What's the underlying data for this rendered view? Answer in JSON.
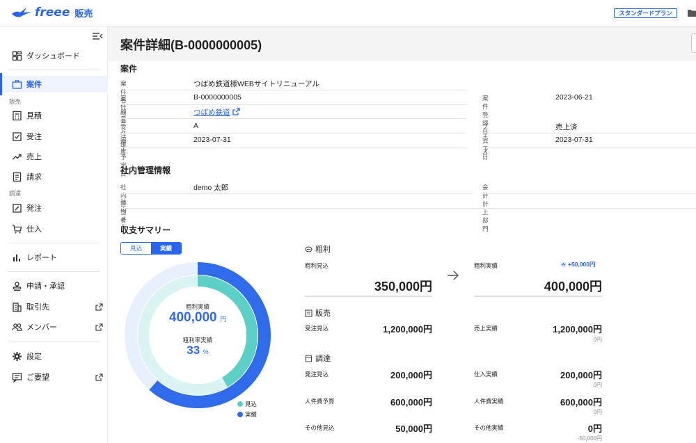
{
  "app": {
    "brand": "freee",
    "product": "販売",
    "plan_badge": "スタンダードプラン"
  },
  "sidebar": {
    "items": [
      {
        "id": "dashboard",
        "label": "ダッシュボード"
      },
      {
        "id": "deals",
        "label": "案件",
        "active": true
      },
      {
        "id": "estimate",
        "label": "見積"
      },
      {
        "id": "order",
        "label": "受注"
      },
      {
        "id": "sales",
        "label": "売上"
      },
      {
        "id": "billing",
        "label": "請求"
      },
      {
        "id": "purchase-order",
        "label": "発注"
      },
      {
        "id": "purchase",
        "label": "仕入"
      },
      {
        "id": "report",
        "label": "レポート"
      },
      {
        "id": "approval",
        "label": "申請・承認"
      },
      {
        "id": "partners",
        "label": "取引先"
      },
      {
        "id": "members",
        "label": "メンバー"
      },
      {
        "id": "settings",
        "label": "設定"
      },
      {
        "id": "feedback",
        "label": "ご要望"
      }
    ],
    "sections": {
      "sales": "販売",
      "procurement": "調達"
    }
  },
  "page": {
    "title": "案件詳細(B-0000000005)"
  },
  "deal": {
    "section_title": "案件",
    "name_label": "案件名",
    "name": "つばめ鉄道様WEBサイトリニューアル",
    "code_label": "案件コード",
    "code": "B-0000000005",
    "registered_label": "案件登録日",
    "registered": "2023-06-21",
    "customer_label": "顧客",
    "customer": "つばめ鉄道",
    "probability_label": "受注確度",
    "probability": "A",
    "phase_label": "フェーズ",
    "phase": "売上済",
    "due_label": "完了予定日",
    "due": "2023-07-31",
    "done_label": "完了日",
    "done": "2023-07-31"
  },
  "internal": {
    "section_title": "社内管理情報",
    "owner_label": "社内担当者",
    "owner": "demo 太郎",
    "dept_label": "会計計上部門",
    "dept": "",
    "memo_label": "社内メモ",
    "memo": ""
  },
  "summary": {
    "section_title": "収支サマリー",
    "toggle": [
      "見込",
      "実績"
    ],
    "toggle_selected": "実績",
    "donut": {
      "profit_label": "粗利実績",
      "profit_value": "400,000",
      "profit_unit": "円",
      "rate_label": "粗利率実績",
      "rate_value": "33",
      "rate_unit": "%",
      "outer_fraction": 0.6154,
      "inner_fraction": 0.4167,
      "outer_color": "#2f6bea",
      "inner_color": "#5ccfc7"
    },
    "legend": [
      {
        "label": "見込",
        "color": "#5ccfc7"
      },
      {
        "label": "実績",
        "color": "#2f6bea"
      }
    ],
    "gross": {
      "title": "粗利",
      "forecast_label": "粗利見込",
      "forecast_value": "350,000円",
      "actual_label": "粗利実績",
      "actual_value": "400,000円",
      "diff": "+50,000円"
    },
    "sales": {
      "title": "販売",
      "forecast_label": "受注見込",
      "forecast_value": "1,200,000円",
      "actual_label": "売上実績",
      "actual_value": "1,200,000円",
      "actual_diff": "0円"
    },
    "procurement": {
      "title": "調達",
      "rows": [
        {
          "forecast_label": "発注見込",
          "forecast_value": "200,000円",
          "actual_label": "仕入実績",
          "actual_value": "200,000円",
          "diff": "0円"
        },
        {
          "forecast_label": "人件費予算",
          "forecast_value": "600,000円",
          "actual_label": "人件費実績",
          "actual_value": "600,000円",
          "diff": "0円"
        },
        {
          "forecast_label": "その他見込",
          "forecast_value": "50,000円",
          "actual_label": "その他実績",
          "actual_value": "0円",
          "diff": "-50,000円"
        }
      ]
    }
  }
}
